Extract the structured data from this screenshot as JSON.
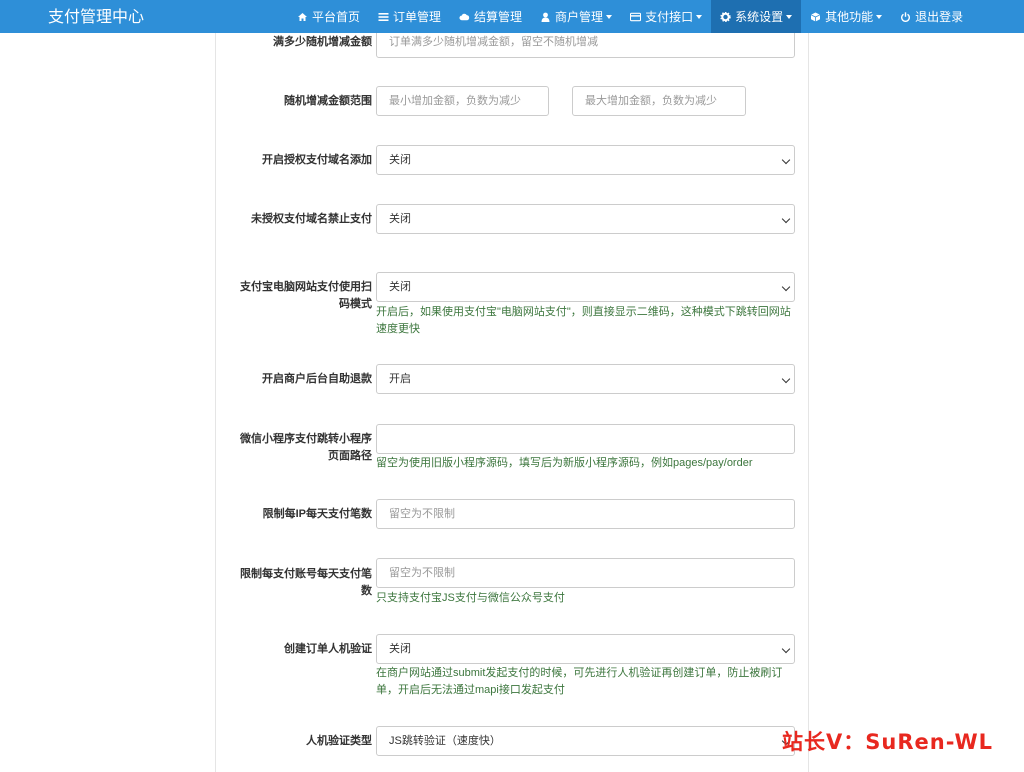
{
  "brand": "支付管理中心",
  "nav": [
    {
      "label": "平台首页",
      "icon": "home-icon"
    },
    {
      "label": "订单管理",
      "icon": "list-icon"
    },
    {
      "label": "结算管理",
      "icon": "cloud-icon"
    },
    {
      "label": "商户管理",
      "icon": "user-icon",
      "caret": true
    },
    {
      "label": "支付接口",
      "icon": "credit-card-icon",
      "caret": true
    },
    {
      "label": "系统设置",
      "icon": "gear-icon",
      "caret": true,
      "active": true
    },
    {
      "label": "其他功能",
      "icon": "cube-icon",
      "caret": true
    },
    {
      "label": "退出登录",
      "icon": "power-icon"
    }
  ],
  "form": {
    "random_amount": {
      "label": "满多少随机增减金额",
      "placeholder": "订单满多少随机增减金额，留空不随机增减"
    },
    "random_range": {
      "label": "随机增减金额范围",
      "min_placeholder": "最小增加金额，负数为减少",
      "max_placeholder": "最大增加金额，负数为减少"
    },
    "auth_domain_add": {
      "label": "开启授权支付域名添加",
      "value": "关闭"
    },
    "unauth_domain_block": {
      "label": "未授权支付域名禁止支付",
      "value": "关闭"
    },
    "alipay_qr_mode": {
      "label": "支付宝电脑网站支付使用扫码模式",
      "value": "关闭",
      "help": "开启后，如果使用支付宝\"电脑网站支付\"，则直接显示二维码，这种模式下跳转回网站速度更快"
    },
    "merchant_refund": {
      "label": "开启商户后台自助退款",
      "value": "开启"
    },
    "wx_mini_path": {
      "label": "微信小程序支付跳转小程序页面路径",
      "value": "",
      "help": "留空为使用旧版小程序源码，填写后为新版小程序源码，例如pages/pay/order"
    },
    "ip_limit": {
      "label": "限制每IP每天支付笔数",
      "placeholder": "留空为不限制"
    },
    "account_limit": {
      "label": "限制每支付账号每天支付笔数",
      "placeholder": "留空为不限制",
      "help": "只支持支付宝JS支付与微信公众号支付"
    },
    "captcha_create": {
      "label": "创建订单人机验证",
      "value": "关闭",
      "help": "在商户网站通过submit发起支付的时候，可先进行人机验证再创建订单，防止被刷订单，开启后无法通过mapi接口发起支付"
    },
    "captcha_type": {
      "label": "人机验证类型",
      "value": "JS跳转验证（速度快）"
    }
  },
  "watermark": "站长V：SuRen-WL"
}
